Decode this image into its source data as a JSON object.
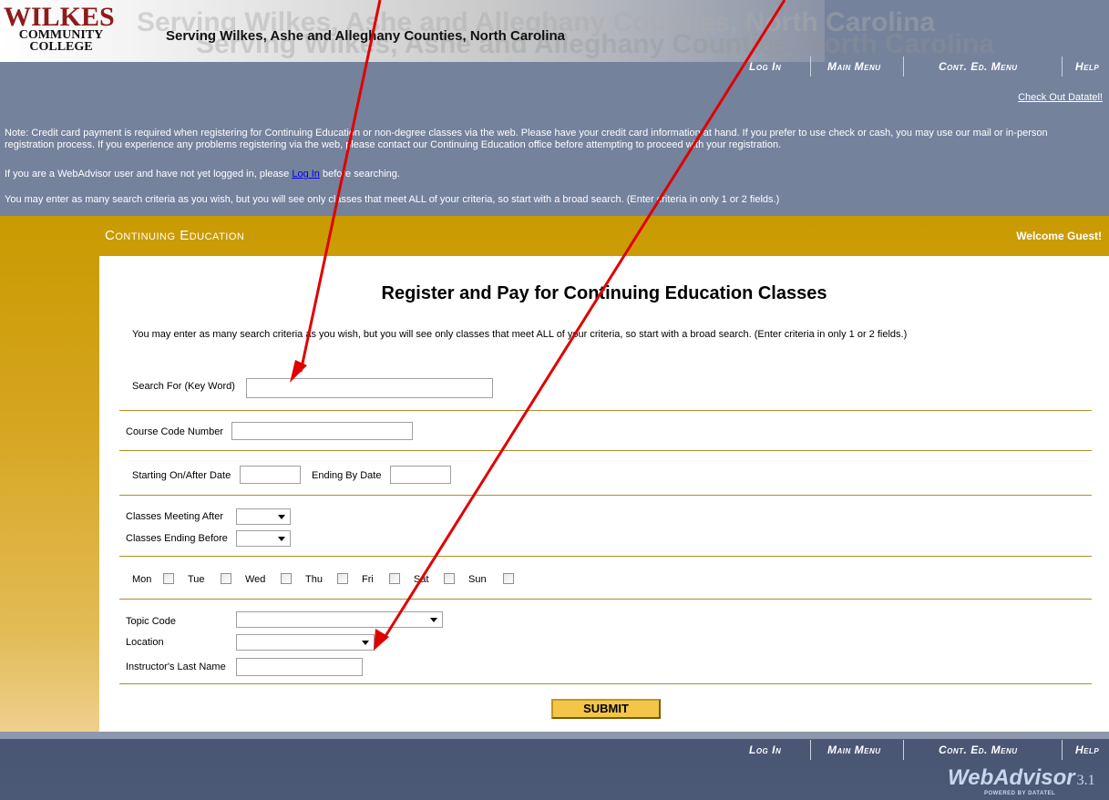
{
  "header": {
    "logo": {
      "line1": "WILKES",
      "line2": "COMMUNITY",
      "line3": "COLLEGE"
    },
    "watermark": "Serving Wilkes, Ashe and Alleghany Counties, North Carolina",
    "tagline": "Serving Wilkes, Ashe and Alleghany Counties, North Carolina"
  },
  "nav": {
    "login": "Log In",
    "main_menu": "Main Menu",
    "cont_ed_menu": "Cont. Ed. Menu",
    "help": "Help"
  },
  "checkout_link": "Check Out Datatel!",
  "notes": {
    "note1": "Note: Credit card payment is required when registering for Continuing Education or non-degree classes via the web. Please have your credit card information at hand. If you prefer to use check or cash, you may use our mail or in-person registration process. If you experience any problems registering via the web, please contact our Continuing Education office before attempting to proceed with your registration.",
    "note2_pre": "If you are a WebAdvisor user and have not yet logged in, please ",
    "note2_link": "Log In",
    "note2_post": " before searching.",
    "note3": "You may enter as many search criteria as you wish, but you will see only classes that meet ALL of your criteria, so start with a broad search. (Enter criteria in only 1 or 2 fields.)"
  },
  "section_title": "Continuing Education",
  "welcome": "Welcome Guest!",
  "form": {
    "page_title": "Register and Pay for Continuing Education Classes",
    "instructions": "You may enter as many search criteria as you wish, but you will see only classes that meet ALL of your criteria, so start with a broad search. (Enter criteria in only 1 or 2 fields.)",
    "keyword_label": "Search For (Key Word)",
    "course_code_label": "Course Code Number",
    "start_date_label": "Starting On/After Date",
    "end_date_label": "Ending By Date",
    "meeting_after_label": "Classes Meeting After",
    "ending_before_label": "Classes Ending Before",
    "days": [
      "Mon",
      "Tue",
      "Wed",
      "Thu",
      "Fri",
      "Sat",
      "Sun"
    ],
    "topic_code_label": "Topic Code",
    "location_label": "Location",
    "instructor_label": "Instructor's Last Name",
    "submit_label": "SUBMIT"
  },
  "footer_logo": {
    "brand": "WebAdvisor",
    "version": "3.1",
    "powered": "POWERED BY DATATEL"
  },
  "colors": {
    "header_bg": "#74829c",
    "gold": "#c99a00",
    "footer_bg": "#4a5673",
    "annotation_arrow": "#e00000"
  }
}
